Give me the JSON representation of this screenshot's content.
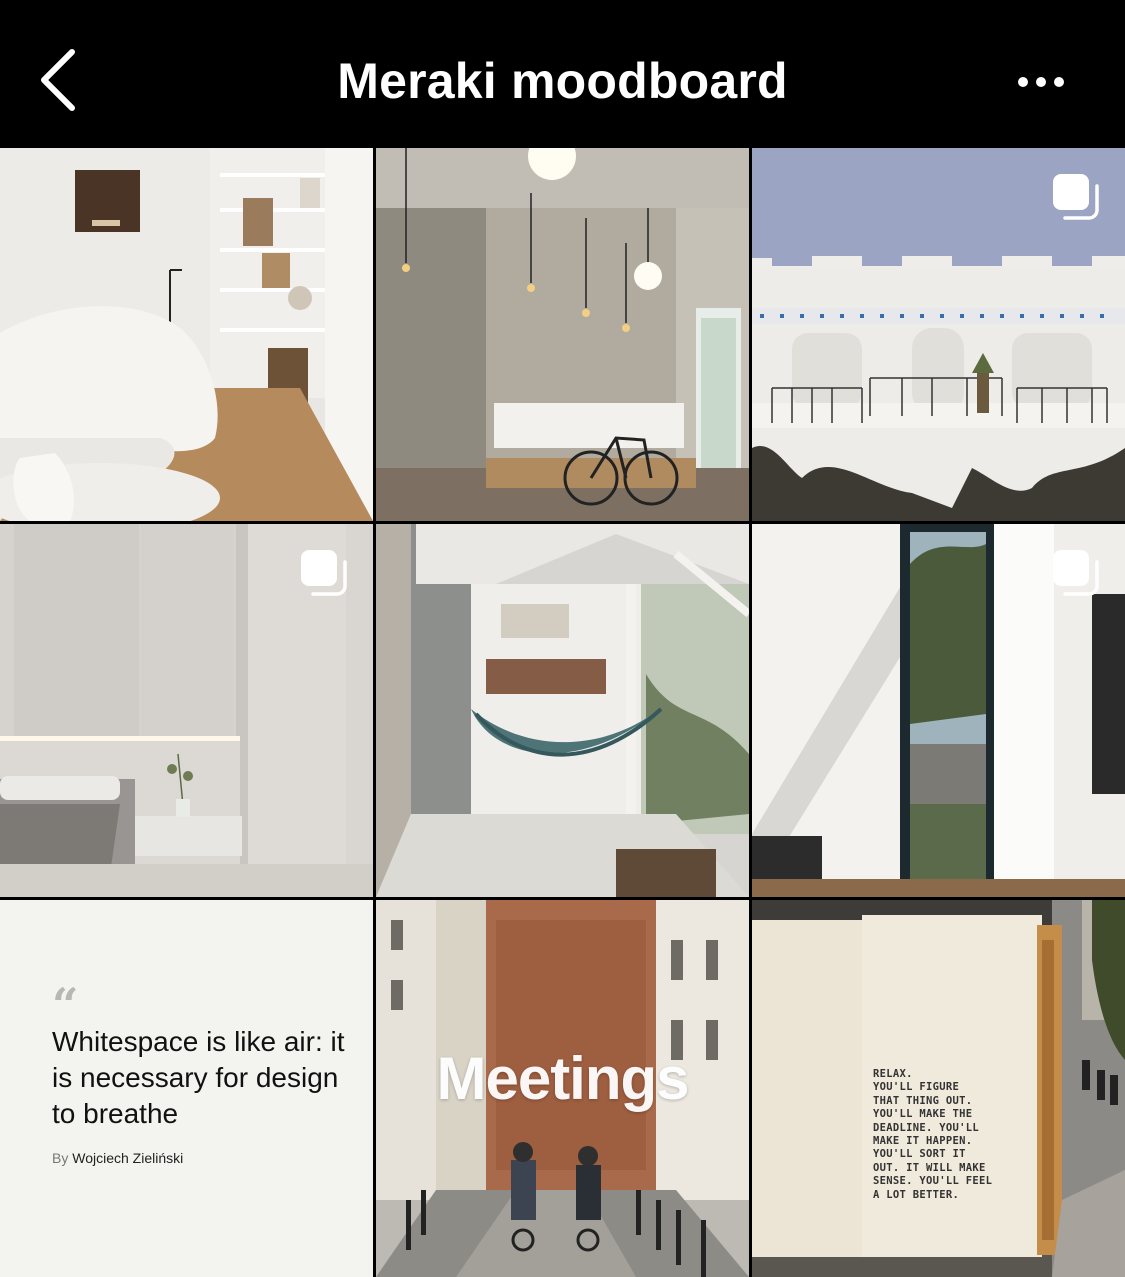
{
  "header": {
    "title": "Meraki moodboard",
    "back_icon": "chevron-left-icon",
    "more_icon": "more-horizontal-icon"
  },
  "grid": {
    "tiles": [
      {
        "subject": "interior-living-room",
        "multiple": false
      },
      {
        "subject": "interior-concrete-hall-bicycle",
        "multiple": false
      },
      {
        "subject": "white-building-facade",
        "multiple": true
      },
      {
        "subject": "interior-bedroom",
        "multiple": true
      },
      {
        "subject": "porch-hammock",
        "multiple": false
      },
      {
        "subject": "interior-tall-window",
        "multiple": true
      },
      {
        "subject": "quote-card",
        "multiple": false
      },
      {
        "subject": "street-cyclists",
        "multiple": false
      },
      {
        "subject": "wall-message",
        "multiple": false
      }
    ],
    "multi_icon": "multiple-images-icon"
  },
  "quote": {
    "mark": "“",
    "text": "Whitespace is like air: it is necessary for design to breathe",
    "by_prefix": "By",
    "author": "Wojciech Zieliński"
  },
  "meetings": {
    "label": "Meetings"
  },
  "wall": {
    "text": "RELAX.\nYOU'LL FIGURE\nTHAT THING OUT.\nYOU'LL MAKE THE\nDEADLINE. YOU'LL\nMAKE IT HAPPEN.\nYOU'LL SORT IT\nOUT. IT WILL MAKE\nSENSE. YOU'LL FEEL\nA LOT BETTER."
  }
}
